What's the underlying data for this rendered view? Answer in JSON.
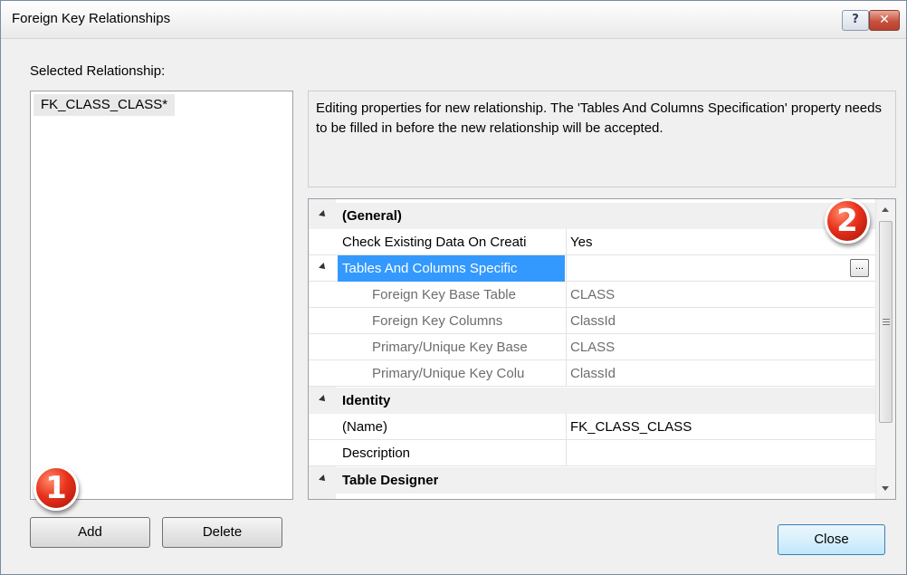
{
  "window": {
    "title": "Foreign Key Relationships",
    "help_glyph": "?",
    "close_glyph": "✕"
  },
  "selected_relationship_label": "Selected Relationship:",
  "relationships": [
    "FK_CLASS_CLASS*"
  ],
  "description": "Editing properties for new relationship.  The 'Tables And Columns Specification' property needs to be filled in before the new relationship will be accepted.",
  "properties": {
    "general": {
      "label": "(General)",
      "check_existing": {
        "name": "Check Existing Data On Creati",
        "value": "Yes"
      },
      "tables_columns": {
        "name": "Tables And Columns Specific",
        "ellipsis": "...",
        "children": [
          {
            "name": "Foreign Key Base Table",
            "value": "CLASS"
          },
          {
            "name": "Foreign Key Columns",
            "value": "ClassId"
          },
          {
            "name": "Primary/Unique Key Base",
            "value": "CLASS"
          },
          {
            "name": "Primary/Unique Key Colu",
            "value": "ClassId"
          }
        ]
      }
    },
    "identity": {
      "label": "Identity",
      "name_row": {
        "name": "(Name)",
        "value": "FK_CLASS_CLASS"
      },
      "description_row": {
        "name": "Description",
        "value": ""
      }
    },
    "table_designer": {
      "label": "Table Designer"
    }
  },
  "buttons": {
    "add": "Add",
    "delete": "Delete",
    "close": "Close"
  },
  "callouts": {
    "one": "1",
    "two": "2"
  },
  "colors": {
    "selection": "#3399ff",
    "callout": "#e8321b",
    "dialog_bg": "#f0f0f0"
  }
}
